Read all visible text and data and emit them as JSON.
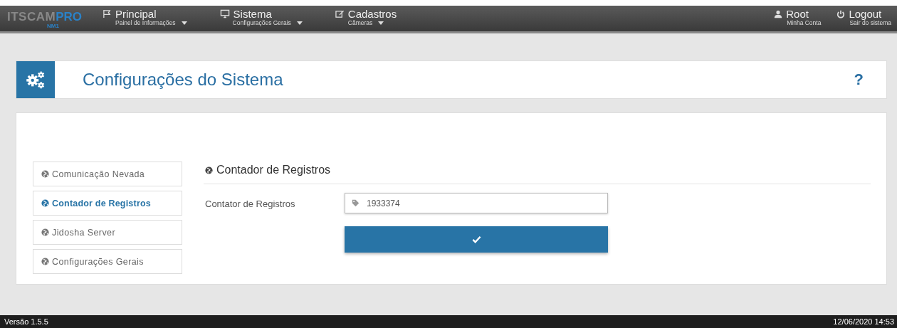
{
  "navbar": {
    "logo": {
      "main": "ITSCAM",
      "accent": "PRO",
      "sub": "NM1"
    },
    "menus": [
      {
        "kind": "flag",
        "label": "Principal",
        "sub": "Painel de Informações"
      },
      {
        "kind": "monitor",
        "label": "Sistema",
        "sub": "Configurações Gerais"
      },
      {
        "kind": "edit",
        "label": "Cadastros",
        "sub": "Câmeras"
      }
    ],
    "user_links": [
      {
        "kind": "user",
        "label": "Root",
        "sub": "Minha Conta"
      },
      {
        "kind": "power",
        "label": "Logout",
        "sub": "Sair do sistema"
      }
    ]
  },
  "page_header": {
    "title": "Configurações do Sistema",
    "help": "?"
  },
  "sidebar": {
    "items": [
      {
        "label": "Comunicação Nevada",
        "selected": false
      },
      {
        "label": "Contador de Registros",
        "selected": true
      },
      {
        "label": "Jidosha Server",
        "selected": false
      },
      {
        "label": "Configurações Gerais",
        "selected": false
      }
    ]
  },
  "panel": {
    "title": "Contador de Registros",
    "field": {
      "label": "Contator de Registros",
      "value": "1933374"
    }
  },
  "status_bar": {
    "version": "Versão  1.5.5",
    "datetime": "12/06/2020 14:53"
  }
}
